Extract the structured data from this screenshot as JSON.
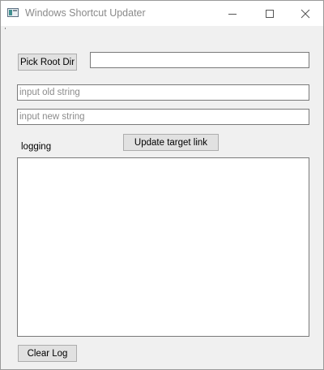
{
  "window": {
    "title": "Windows Shortcut Updater"
  },
  "toolbar": {
    "pick_root_label": "Pick Root Dir",
    "root_dir_value": ""
  },
  "inputs": {
    "old_string_placeholder": "input old string",
    "old_string_value": "",
    "new_string_placeholder": "input new string",
    "new_string_value": ""
  },
  "actions": {
    "update_label": "Update target link",
    "clear_log_label": "Clear Log"
  },
  "log": {
    "label": "logging",
    "content": ""
  },
  "icons": {
    "app": "app-window-icon",
    "minimize": "minimize-icon",
    "maximize": "maximize-icon",
    "close": "close-icon"
  }
}
